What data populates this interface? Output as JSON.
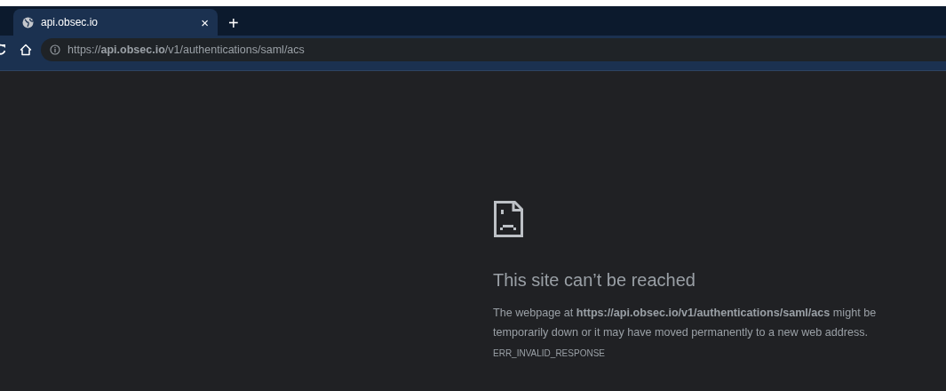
{
  "tabs": [
    {
      "title": "api.obsec.io",
      "selected": true,
      "close": "×"
    }
  ],
  "new_tab": "+",
  "address_bar": {
    "url": "https://**api.obsec.io**/v1/authentications/saml/acs"
  },
  "error_page": {
    "heading": "This site can’t be reached",
    "message": "The webpage at **https://api.obsec.io/v1/authentications/saml/acs** might be temporarily down or it may have moved permanently to a new web address.",
    "code": "ERR_INVALID_RESPONSE"
  }
}
